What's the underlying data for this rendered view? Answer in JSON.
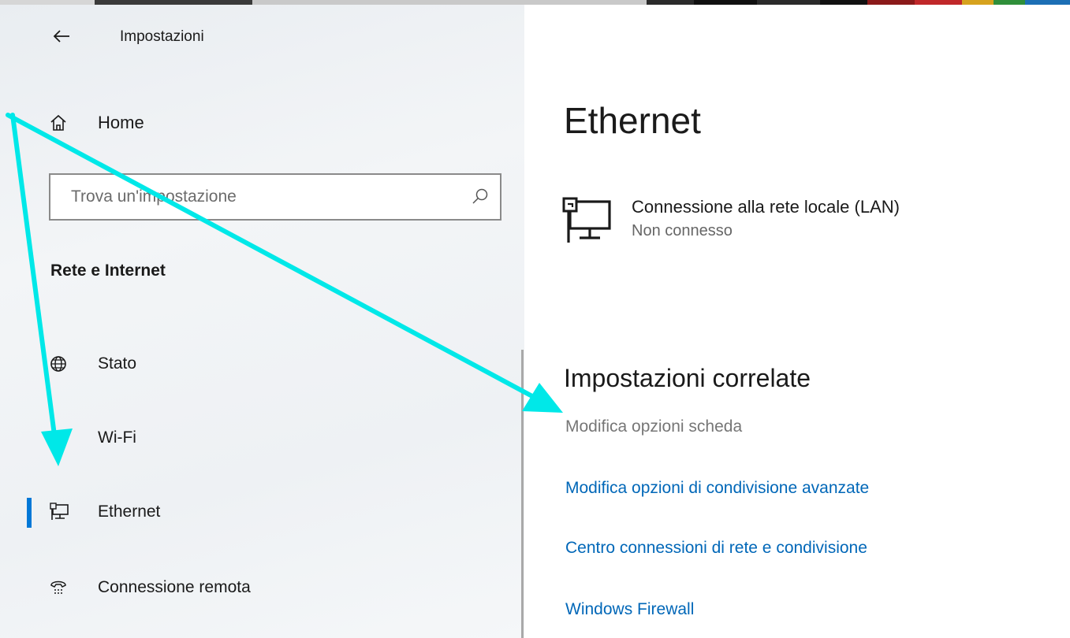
{
  "colors": {
    "accent": "#0078d7",
    "link": "#0067b8",
    "annotation_arrow": "#00e5e5"
  },
  "header": {
    "back_icon": "arrow-left-icon",
    "title": "Impostazioni"
  },
  "sidebar": {
    "home_label": "Home",
    "home_icon": "home-icon",
    "search": {
      "placeholder": "Trova un'impostazione",
      "icon": "search-icon"
    },
    "section_title": "Rete e Internet",
    "items": [
      {
        "label": "Stato",
        "icon": "globe-icon",
        "selected": false
      },
      {
        "label": "Wi-Fi",
        "icon": "wifi-icon",
        "selected": false
      },
      {
        "label": "Ethernet",
        "icon": "ethernet-icon",
        "selected": true
      },
      {
        "label": "Connessione remota",
        "icon": "dialup-icon",
        "selected": false
      }
    ]
  },
  "main": {
    "title": "Ethernet",
    "connection": {
      "icon": "network-computer-icon",
      "name": "Connessione alla rete locale (LAN)",
      "status": "Non connesso"
    },
    "related": {
      "title": "Impostazioni correlate",
      "links": [
        {
          "label": "Modifica opzioni scheda",
          "enabled": false
        },
        {
          "label": "Modifica opzioni di condivisione avanzate",
          "enabled": true
        },
        {
          "label": "Centro connessioni di rete e condivisione",
          "enabled": true
        },
        {
          "label": "Windows Firewall",
          "enabled": true
        }
      ]
    }
  }
}
